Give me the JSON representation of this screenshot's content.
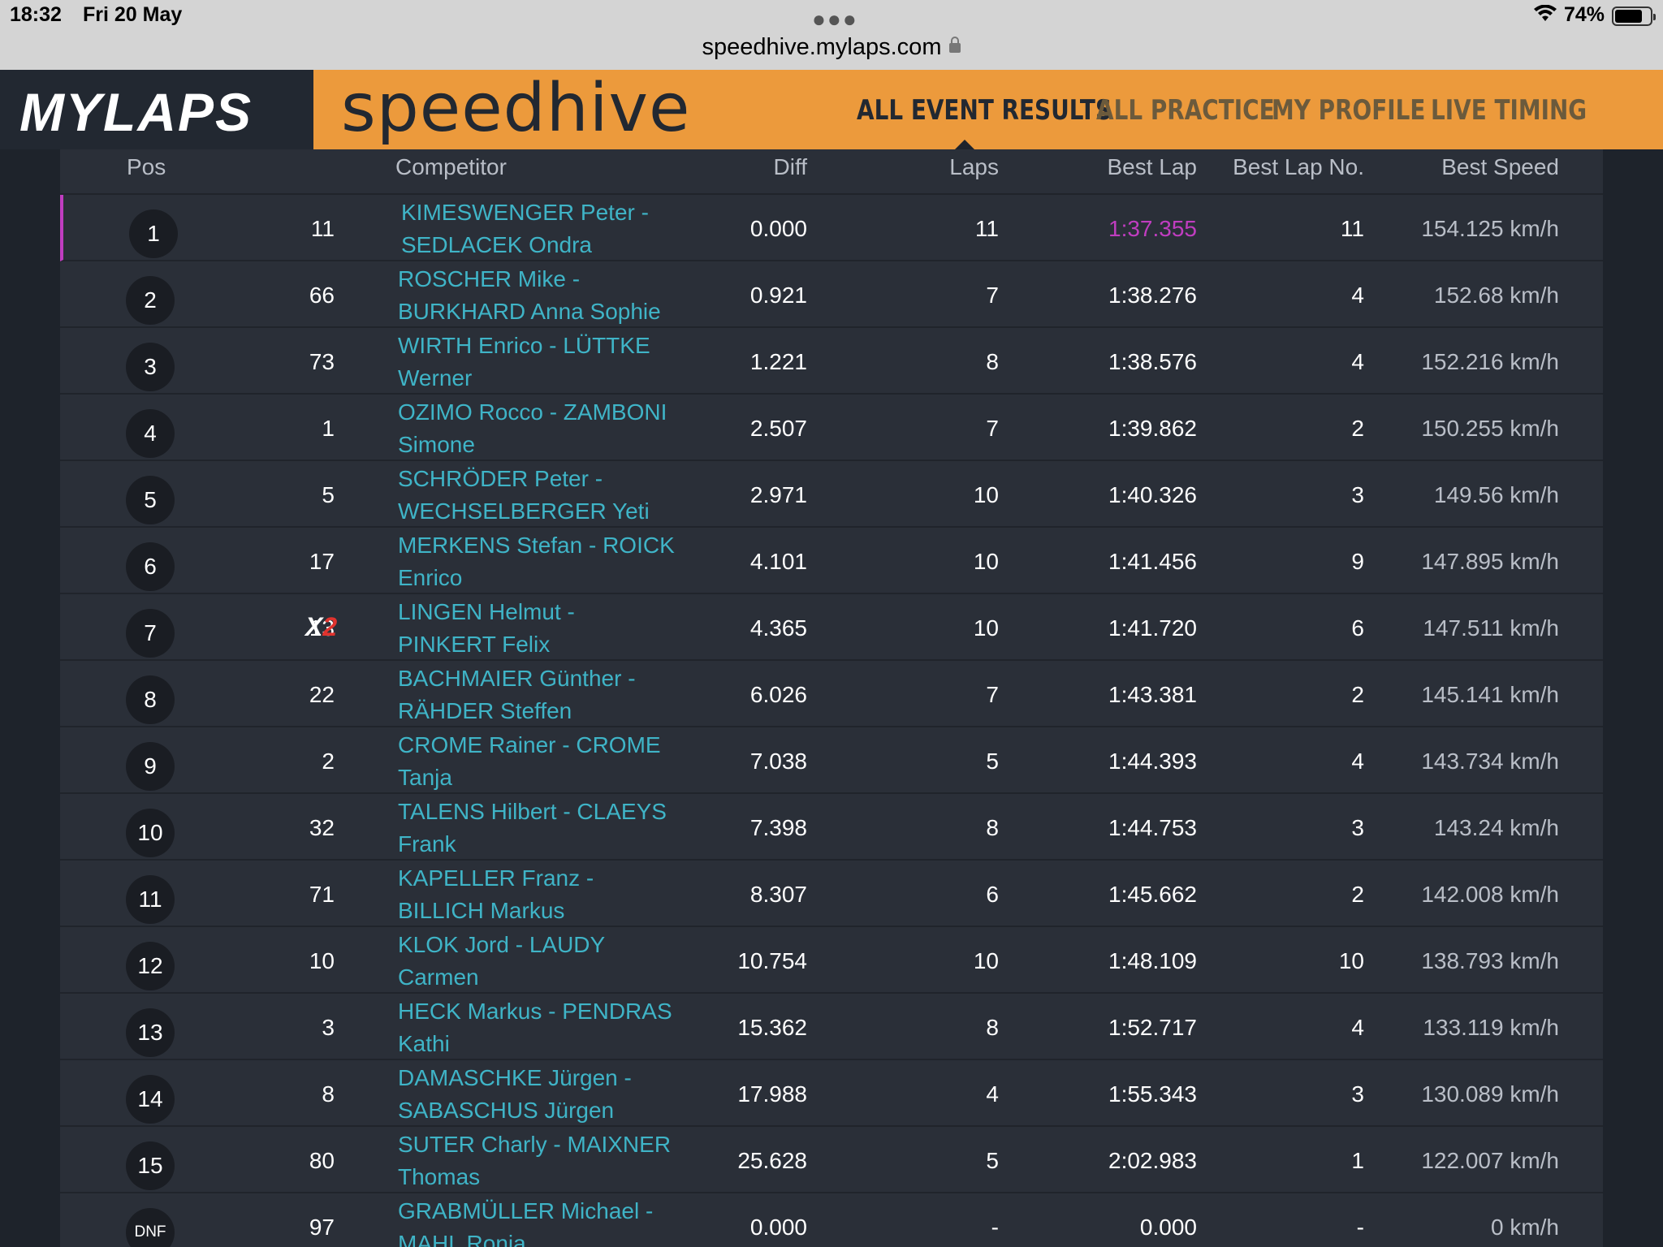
{
  "status_bar": {
    "time": "18:32",
    "date": "Fri 20 May",
    "url": "speedhive.mylaps.com",
    "battery": "74%",
    "battery_level": 0.74
  },
  "header": {
    "logo": "MYLAPS",
    "brand": "speedhive",
    "nav": [
      {
        "label": "ALL EVENT RESULTS",
        "active": true
      },
      {
        "label": "ALL PRACTICE",
        "active": false
      },
      {
        "label": "MY PROFILE",
        "active": false
      },
      {
        "label": "LIVE TIMING",
        "active": false
      }
    ],
    "colors": {
      "accent": "#ec9a3c",
      "dark": "#222831",
      "link": "#3fb4c7",
      "best": "#c03dc0",
      "x2_red": "#e0332e"
    }
  },
  "table": {
    "columns": {
      "pos": "Pos",
      "competitor": "Competitor",
      "diff": "Diff",
      "laps": "Laps",
      "best_lap": "Best Lap",
      "best_lap_no": "Best Lap No.",
      "best_speed": "Best Speed"
    },
    "rows": [
      {
        "pos": "1",
        "num": "11",
        "tag": "",
        "c1": "KIMESWENGER Peter -",
        "c2": "SEDLACEK Ondra",
        "diff": "0.000",
        "laps": "11",
        "best": "1:37.355",
        "bestno": "11",
        "speed": "154.125 km/h"
      },
      {
        "pos": "2",
        "num": "66",
        "tag": "",
        "c1": "ROSCHER Mike -",
        "c2": "BURKHARD Anna Sophie",
        "diff": "0.921",
        "laps": "7",
        "best": "1:38.276",
        "bestno": "4",
        "speed": "152.68 km/h"
      },
      {
        "pos": "3",
        "num": "73",
        "tag": "",
        "c1": "WIRTH Enrico - LÜTTKE",
        "c2": "Werner",
        "diff": "1.221",
        "laps": "8",
        "best": "1:38.576",
        "bestno": "4",
        "speed": "152.216 km/h"
      },
      {
        "pos": "4",
        "num": "1",
        "tag": "",
        "c1": "OZIMO Rocco - ZAMBONI",
        "c2": "Simone",
        "diff": "2.507",
        "laps": "7",
        "best": "1:39.862",
        "bestno": "2",
        "speed": "150.255 km/h"
      },
      {
        "pos": "5",
        "num": "5",
        "tag": "",
        "c1": "SCHRÖDER Peter -",
        "c2": "WECHSELBERGER Yeti",
        "diff": "2.971",
        "laps": "10",
        "best": "1:40.326",
        "bestno": "3",
        "speed": "149.56 km/h"
      },
      {
        "pos": "6",
        "num": "17",
        "tag": "",
        "c1": "MERKENS Stefan - ROICK",
        "c2": "Enrico",
        "diff": "4.101",
        "laps": "10",
        "best": "1:41.456",
        "bestno": "9",
        "speed": "147.895 km/h"
      },
      {
        "pos": "7",
        "num": "13",
        "tag": "X2",
        "c1": "LINGEN Helmut -",
        "c2": "PINKERT Felix",
        "diff": "4.365",
        "laps": "10",
        "best": "1:41.720",
        "bestno": "6",
        "speed": "147.511 km/h"
      },
      {
        "pos": "8",
        "num": "22",
        "tag": "",
        "c1": "BACHMAIER Günther -",
        "c2": "RÄHDER Steffen",
        "diff": "6.026",
        "laps": "7",
        "best": "1:43.381",
        "bestno": "2",
        "speed": "145.141 km/h"
      },
      {
        "pos": "9",
        "num": "2",
        "tag": "",
        "c1": "CROME Rainer - CROME",
        "c2": "Tanja",
        "diff": "7.038",
        "laps": "5",
        "best": "1:44.393",
        "bestno": "4",
        "speed": "143.734 km/h"
      },
      {
        "pos": "10",
        "num": "32",
        "tag": "",
        "c1": "TALENS Hilbert - CLAEYS",
        "c2": "Frank",
        "diff": "7.398",
        "laps": "8",
        "best": "1:44.753",
        "bestno": "3",
        "speed": "143.24 km/h"
      },
      {
        "pos": "11",
        "num": "71",
        "tag": "",
        "c1": "KAPELLER Franz -",
        "c2": "BILLICH Markus",
        "diff": "8.307",
        "laps": "6",
        "best": "1:45.662",
        "bestno": "2",
        "speed": "142.008 km/h"
      },
      {
        "pos": "12",
        "num": "10",
        "tag": "",
        "c1": "KLOK Jord - LAUDY",
        "c2": "Carmen",
        "diff": "10.754",
        "laps": "10",
        "best": "1:48.109",
        "bestno": "10",
        "speed": "138.793 km/h"
      },
      {
        "pos": "13",
        "num": "3",
        "tag": "",
        "c1": "HECK Markus - PENDRAS",
        "c2": "Kathi",
        "diff": "15.362",
        "laps": "8",
        "best": "1:52.717",
        "bestno": "4",
        "speed": "133.119 km/h"
      },
      {
        "pos": "14",
        "num": "8",
        "tag": "",
        "c1": "DAMASCHKE Jürgen -",
        "c2": "SABASCHUS Jürgen",
        "diff": "17.988",
        "laps": "4",
        "best": "1:55.343",
        "bestno": "3",
        "speed": "130.089 km/h"
      },
      {
        "pos": "15",
        "num": "80",
        "tag": "",
        "c1": "SUTER Charly - MAIXNER",
        "c2": "Thomas",
        "diff": "25.628",
        "laps": "5",
        "best": "2:02.983",
        "bestno": "1",
        "speed": "122.007 km/h"
      },
      {
        "pos": "DNF",
        "num": "97",
        "tag": "",
        "c1": "GRABMÜLLER Michael -",
        "c2": "MAHL Ronja",
        "diff": "0.000",
        "laps": "-",
        "best": "0.000",
        "bestno": "-",
        "speed": "0 km/h"
      }
    ]
  }
}
